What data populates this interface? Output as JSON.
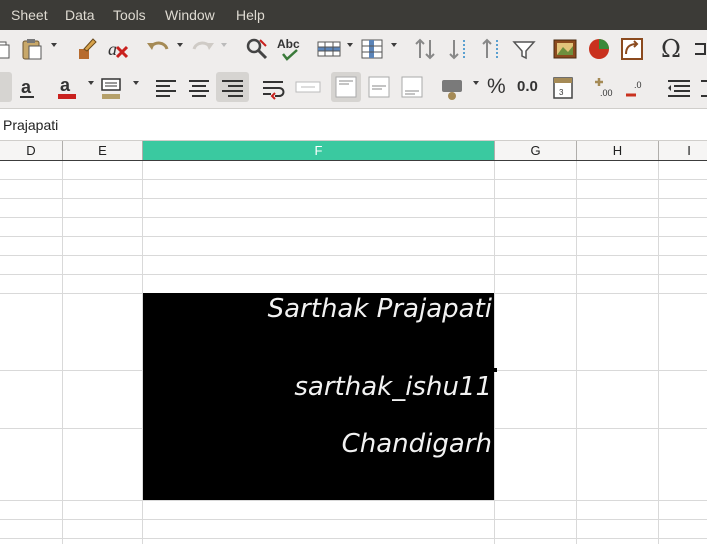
{
  "menu": {
    "items": [
      "Sheet",
      "Data",
      "Tools",
      "Window",
      "Help"
    ]
  },
  "toolbar2": {
    "percent_label": "%",
    "number_label": "0.0"
  },
  "toolbar1": {
    "spell_label": "Abc",
    "omega_label": "Ω"
  },
  "formula_bar": {
    "content": "Prajapati"
  },
  "columns": [
    {
      "label": "D"
    },
    {
      "label": "E"
    },
    {
      "label": "F",
      "selected": true
    },
    {
      "label": "G"
    },
    {
      "label": "H"
    },
    {
      "label": "I"
    }
  ],
  "cells": {
    "f_row8": "Sarthak Prajapati",
    "f_row10": "sarthak_ishu11",
    "f_row11": "Chandigarh"
  },
  "colors": {
    "accent_selected_column": "#3ac9a0",
    "menubar_bg": "#3c3b37",
    "font_color_red": "#c9211e",
    "cell_fill": "#000000"
  }
}
